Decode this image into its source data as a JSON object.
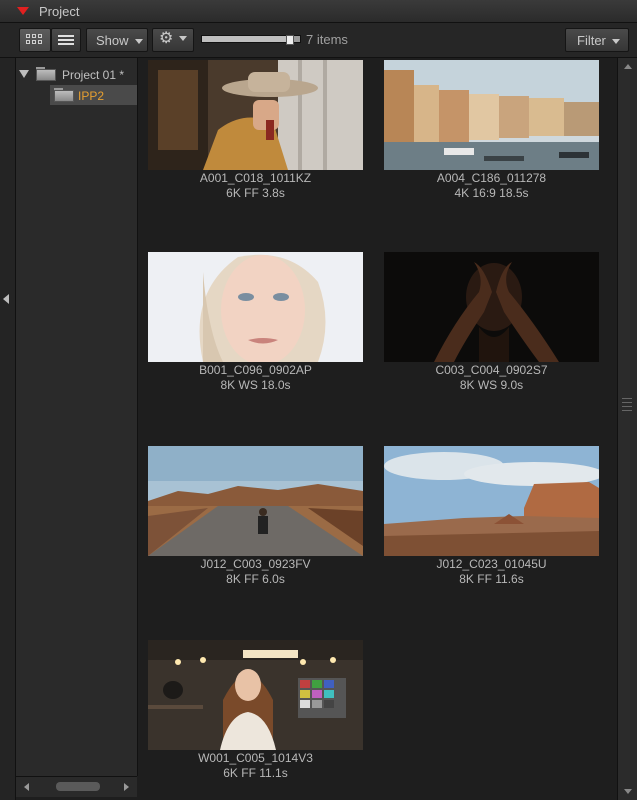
{
  "panel": {
    "title": "Project"
  },
  "toolbar": {
    "show_label": "Show",
    "items_count": "7 items",
    "filter_label": "Filter",
    "thumbnail_size_level": 0.9
  },
  "tree": {
    "project_label": "Project 01 *",
    "folder_label": "IPP2"
  },
  "colors": {
    "accent": "#e02020",
    "selected_folder_text": "#e8a030",
    "selected_row_bg": "#4a4a4a"
  },
  "clips": [
    {
      "name": "A001_C018_1011KZ",
      "meta": "6K FF   3.8s"
    },
    {
      "name": "A004_C186_011278",
      "meta": "4K 16:9   18.5s"
    },
    {
      "name": "B001_C096_0902AP",
      "meta": "8K WS   18.0s"
    },
    {
      "name": "C003_C004_0902S7",
      "meta": "8K WS   9.0s"
    },
    {
      "name": "J012_C003_0923FV",
      "meta": "8K FF   6.0s"
    },
    {
      "name": "J012_C023_01045U",
      "meta": "8K FF   11.6s"
    },
    {
      "name": "W001_C005_1014V3",
      "meta": "6K FF   11.1s"
    }
  ]
}
